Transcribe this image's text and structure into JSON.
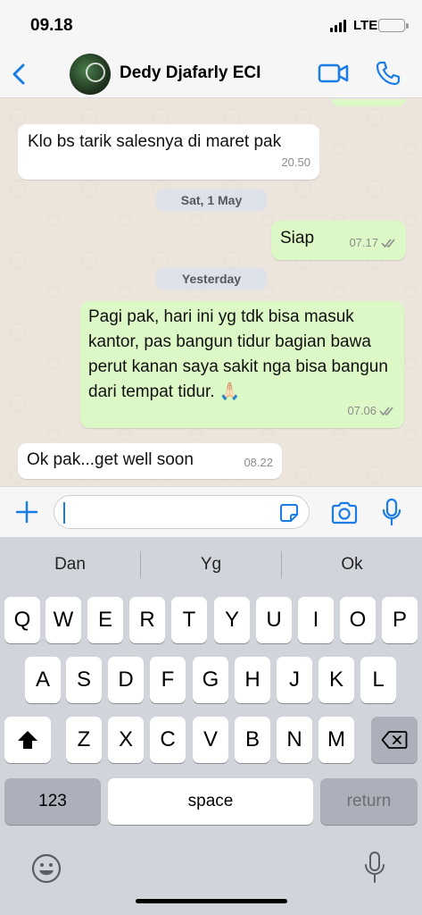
{
  "status_bar": {
    "time": "09.18",
    "network": "LTE"
  },
  "header": {
    "back_icon": "chevron-left-icon",
    "contact_name": "Dedy Djafarly ECI",
    "video_icon": "video-camera-icon",
    "call_icon": "phone-icon",
    "accent_color": "#1a7ce6"
  },
  "messages": [
    {
      "direction": "incoming",
      "text": "Klo bs tarik salesnya di maret pak",
      "time": "20.50"
    },
    {
      "type": "date",
      "text": "Sat, 1 May"
    },
    {
      "direction": "outgoing",
      "text": "Siap",
      "time": "07.17",
      "status": "read"
    },
    {
      "type": "date",
      "text": "Yesterday"
    },
    {
      "direction": "outgoing",
      "text": "Pagi pak, hari ini yg tdk bisa masuk kantor, pas bangun tidur bagian bawa perut kanan saya sakit nga bisa bangun dari tempat tidur. 🙏🏻",
      "time": "07.06",
      "status": "read"
    },
    {
      "direction": "incoming",
      "text": "Ok pak...get well soon",
      "time": "08.22"
    }
  ],
  "composer": {
    "value": "",
    "plus_icon": "plus-icon",
    "sticker_icon": "sticker-icon",
    "camera_icon": "camera-icon",
    "mic_icon": "microphone-icon"
  },
  "keyboard": {
    "suggestions": [
      "Dan",
      "Yg",
      "Ok"
    ],
    "row1": [
      "Q",
      "W",
      "E",
      "R",
      "T",
      "Y",
      "U",
      "I",
      "O",
      "P"
    ],
    "row2": [
      "A",
      "S",
      "D",
      "F",
      "G",
      "H",
      "J",
      "K",
      "L"
    ],
    "row3": [
      "Z",
      "X",
      "C",
      "V",
      "B",
      "N",
      "M"
    ],
    "numbers_label": "123",
    "space_label": "space",
    "return_label": "return",
    "shift_icon": "shift-icon",
    "delete_icon": "delete-icon",
    "emoji_icon": "emoji-icon",
    "dictation_icon": "microphone-icon"
  },
  "colors": {
    "incoming_bubble": "#ffffff",
    "outgoing_bubble": "#dcf8c6",
    "read_ticks": "#8c8c8c"
  }
}
